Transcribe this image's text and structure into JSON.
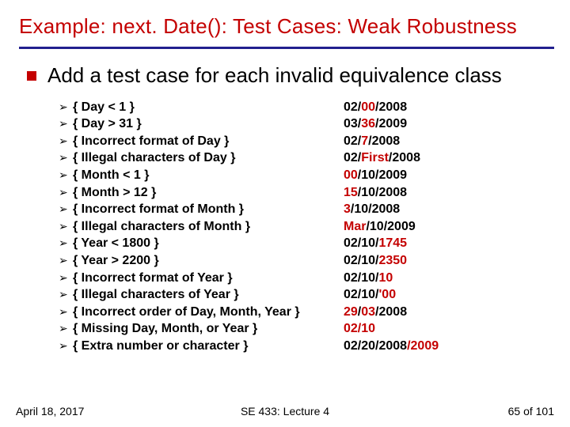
{
  "title": "Example: next. Date(): Test Cases: Weak Robustness",
  "main_bullet": "Add a test case for each invalid equivalence class",
  "rows": [
    {
      "desc": "{ Day < 1 }",
      "ex_pre": "02/",
      "ex_hl": "00",
      "ex_post": "/2008"
    },
    {
      "desc": "{ Day > 31 }",
      "ex_pre": "03/",
      "ex_hl": "36",
      "ex_post": "/2009"
    },
    {
      "desc": "{ Incorrect format of Day }",
      "ex_pre": "02/",
      "ex_hl": "7",
      "ex_post": "/2008"
    },
    {
      "desc": "{ Illegal characters of Day }",
      "ex_pre": "02/",
      "ex_hl": "First",
      "ex_post": "/2008"
    },
    {
      "desc": "{ Month < 1 }",
      "ex_pre": "",
      "ex_hl": "00",
      "ex_post": "/10/2009"
    },
    {
      "desc": "{ Month > 12 }",
      "ex_pre": "",
      "ex_hl": "15",
      "ex_post": "/10/2008"
    },
    {
      "desc": "{ Incorrect format of Month }",
      "ex_pre": "",
      "ex_hl": "3",
      "ex_post": "/10/2008"
    },
    {
      "desc": "{ Illegal characters of Month }",
      "ex_pre": "",
      "ex_hl": "Mar",
      "ex_post": "/10/2009"
    },
    {
      "desc": "{ Year < 1800 }",
      "ex_pre": "02/10/",
      "ex_hl": "1745",
      "ex_post": ""
    },
    {
      "desc": "{ Year > 2200 }",
      "ex_pre": "02/10/",
      "ex_hl": "2350",
      "ex_post": ""
    },
    {
      "desc": "{ Incorrect format of Year }",
      "ex_pre": "02/10/",
      "ex_hl": "10",
      "ex_post": ""
    },
    {
      "desc": "{ Illegal characters of Year }",
      "ex_pre": "02/10/",
      "ex_hl": "'00",
      "ex_post": ""
    },
    {
      "desc": "{ Incorrect order of Day, Month, Year }",
      "ex_pre": "",
      "ex_hl": "29",
      "ex_post": "/03/2008",
      "hl2": "03",
      "raw": "29/03/2008"
    },
    {
      "desc": "{ Missing Day, Month, or Year }",
      "ex_pre": "",
      "ex_hl": "02/10",
      "ex_post": ""
    },
    {
      "desc": "{ Extra number or character }",
      "ex_pre": "02/20/2008",
      "ex_hl": "/2009",
      "ex_post": ""
    }
  ],
  "footer": {
    "date": "April 18, 2017",
    "course": "SE 433: Lecture 4",
    "page": "65 of 101"
  }
}
